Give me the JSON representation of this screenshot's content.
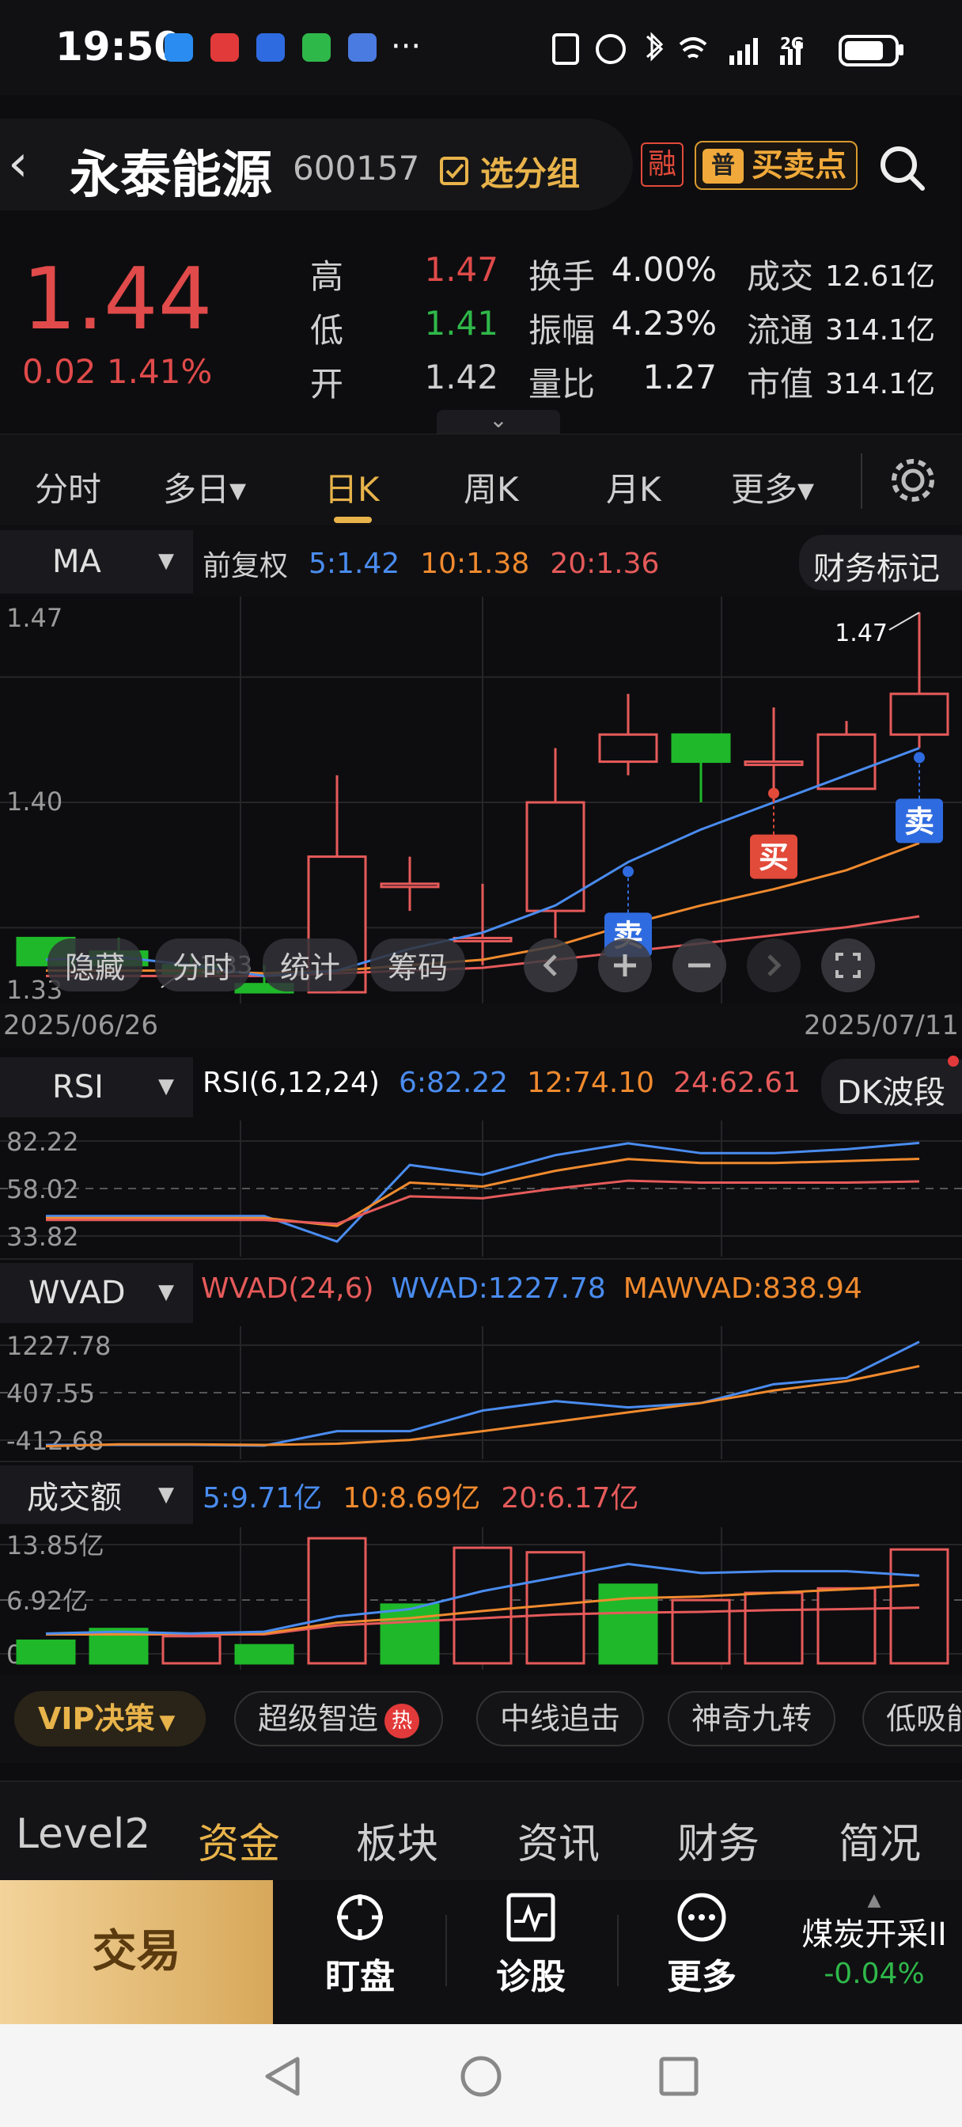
{
  "status_bar": {
    "time": "19:50",
    "more": "···",
    "network": "2G"
  },
  "header": {
    "back": "‹",
    "name": "永泰能源",
    "code": "600157",
    "group_label": "选分组",
    "rong": "融",
    "buy_sell_label": "买卖点",
    "pu": "普"
  },
  "quote": {
    "price": "1.44",
    "change": "0.02",
    "change_pct": "1.41%",
    "rows": [
      [
        {
          "k": "高",
          "v": "1.47",
          "c": "#e04a4a"
        },
        {
          "k": "换手",
          "v": "4.00%"
        },
        {
          "k": "成交",
          "v": "12.61亿"
        }
      ],
      [
        {
          "k": "低",
          "v": "1.41",
          "c": "#2fb84a"
        },
        {
          "k": "振幅",
          "v": "4.23%"
        },
        {
          "k": "流通",
          "v": "314.1亿"
        }
      ],
      [
        {
          "k": "开",
          "v": "1.42",
          "c": "#cfcfcf"
        },
        {
          "k": "量比",
          "v": "1.27"
        },
        {
          "k": "市值",
          "v": "314.1亿"
        }
      ]
    ],
    "expand": "⌄"
  },
  "tabs": {
    "items": [
      "分时",
      "多日▾",
      "日K",
      "周K",
      "月K",
      "更多▾"
    ],
    "active": 2
  },
  "ma_panel": {
    "selector": "MA",
    "adjust": "前复权",
    "ma5": "5:1.42",
    "ma10": "10:1.38",
    "ma20": "20:1.36",
    "finance_btn": "财务标记",
    "y_max": "1.47",
    "y_mid": "1.40",
    "y_min": "1.33",
    "hi_label": "1.47",
    "lo_label": "1.33",
    "date_start": "2025/06/26",
    "date_end": "2025/07/11",
    "sell_label": "卖",
    "buy_label": "买",
    "toolbar": {
      "hide": "隐藏",
      "fenshi": "分时",
      "stats": "统计",
      "chips": "筹码"
    }
  },
  "rsi_panel": {
    "selector": "RSI",
    "title": "RSI(6,12,24)",
    "v6": "6:82.22",
    "v12": "12:74.10",
    "v24": "24:62.61",
    "btn": "DK波段",
    "y1": "82.22",
    "y2": "58.02",
    "y3": "33.82"
  },
  "wvad_panel": {
    "selector": "WVAD",
    "title": "WVAD(24,6)",
    "v1": "WVAD:1227.78",
    "v2": "MAWVAD:838.94",
    "y1": "1227.78",
    "y2": "407.55",
    "y3": "-412.68"
  },
  "amount_panel": {
    "selector": "成交额",
    "v5": "5:9.71亿",
    "v10": "10:8.69亿",
    "v20": "20:6.17亿",
    "y1": "13.85亿",
    "y2": "6.92亿",
    "y3": "0.00"
  },
  "vip_row": {
    "vip": "VIP决策",
    "chips": [
      "超级智造",
      "中线追击",
      "神奇九转",
      "低吸能"
    ],
    "hot": "热"
  },
  "bottom_tabs": {
    "items": [
      "Level2",
      "资金",
      "板块",
      "资讯",
      "财务",
      "简况"
    ],
    "active": 1
  },
  "bottom_bar": {
    "trade": "交易",
    "watch": "盯盘",
    "diagnose": "诊股",
    "more": "更多",
    "sector_name": "煤炭开采II",
    "sector_change": "-0.04%"
  },
  "colors": {
    "up": "#e04a4a",
    "down": "#2fb84a",
    "ma5": "#4a8cf0",
    "ma10": "#f08a2e",
    "ma20": "#e65a5a",
    "accent": "#e8b34a"
  },
  "chart_data": [
    {
      "type": "candlestick",
      "title": "",
      "x_range": [
        "2025/06/26",
        "2025/07/11"
      ],
      "ylim": [
        1.33,
        1.47
      ],
      "candles": [
        {
          "o": 1.35,
          "h": 1.35,
          "l": 1.34,
          "c": 1.34
        },
        {
          "o": 1.345,
          "h": 1.35,
          "l": 1.34,
          "c": 1.34
        },
        {
          "o": 1.34,
          "h": 1.344,
          "l": 1.339,
          "c": 1.336
        },
        {
          "o": 1.333,
          "h": 1.34,
          "l": 1.33,
          "c": 1.33
        },
        {
          "o": 1.33,
          "h": 1.41,
          "l": 1.33,
          "c": 1.38
        },
        {
          "o": 1.37,
          "h": 1.38,
          "l": 1.36,
          "c": 1.37
        },
        {
          "o": 1.35,
          "h": 1.37,
          "l": 1.34,
          "c": 1.35
        },
        {
          "o": 1.36,
          "h": 1.42,
          "l": 1.35,
          "c": 1.4
        },
        {
          "o": 1.415,
          "h": 1.44,
          "l": 1.41,
          "c": 1.425
        },
        {
          "o": 1.425,
          "h": 1.425,
          "l": 1.4,
          "c": 1.415
        },
        {
          "o": 1.415,
          "h": 1.435,
          "l": 1.4,
          "c": 1.415
        },
        {
          "o": 1.405,
          "h": 1.43,
          "l": 1.405,
          "c": 1.425
        },
        {
          "o": 1.425,
          "h": 1.47,
          "l": 1.42,
          "c": 1.44
        }
      ],
      "ma5": [
        1.342,
        1.343,
        1.34,
        1.336,
        1.338,
        1.346,
        1.352,
        1.362,
        1.378,
        1.39,
        1.4,
        1.41,
        1.42
      ],
      "ma10": [
        1.338,
        1.338,
        1.338,
        1.337,
        1.338,
        1.34,
        1.342,
        1.347,
        1.355,
        1.362,
        1.368,
        1.375,
        1.385
      ],
      "ma20": [
        1.336,
        1.336,
        1.336,
        1.336,
        1.337,
        1.338,
        1.339,
        1.342,
        1.345,
        1.348,
        1.351,
        1.354,
        1.358
      ],
      "signals": [
        {
          "index": 8,
          "type": "卖"
        },
        {
          "index": 10,
          "type": "买"
        },
        {
          "index": 12,
          "type": "卖"
        }
      ]
    },
    {
      "type": "line",
      "title": "RSI(6,12,24)",
      "ylim": [
        30,
        88
      ],
      "series": [
        {
          "name": "6",
          "values": [
            45,
            45,
            45,
            45,
            32,
            71,
            66,
            76,
            82,
            77,
            77,
            79,
            82.22
          ]
        },
        {
          "name": "12",
          "values": [
            44,
            44,
            44,
            44,
            40,
            62,
            60,
            68,
            74,
            72,
            72,
            73,
            74.1
          ]
        },
        {
          "name": "24",
          "values": [
            43,
            43,
            43,
            43,
            41,
            55,
            54,
            59,
            63,
            62,
            62,
            62,
            62.61
          ]
        }
      ]
    },
    {
      "type": "line",
      "title": "WVAD(24,6)",
      "ylim": [
        -470,
        1300
      ],
      "series": [
        {
          "name": "WVAD",
          "values": [
            -420,
            -420,
            -420,
            -430,
            -200,
            -200,
            130,
            280,
            180,
            250,
            550,
            650,
            1227.78
          ]
        },
        {
          "name": "MAWVAD",
          "values": [
            -440,
            -410,
            -410,
            -420,
            -400,
            -340,
            -200,
            -50,
            100,
            250,
            450,
            600,
            838.94
          ]
        }
      ]
    },
    {
      "type": "bar",
      "title": "成交额",
      "ylim": [
        0,
        13.85
      ],
      "values": [
        2.5,
        3.8,
        3.0,
        2.0,
        13.85,
        6.5,
        12.8,
        12.3,
        8.7,
        7.0,
        7.8,
        8.3,
        12.61
      ],
      "up": [
        false,
        false,
        true,
        false,
        true,
        false,
        true,
        true,
        false,
        true,
        true,
        true,
        true
      ],
      "ma5": [
        3.3,
        3.5,
        3.3,
        3.5,
        5.2,
        6.0,
        8.0,
        9.5,
        11.0,
        10.0,
        10.2,
        10.2,
        9.71
      ],
      "ma10": [
        3.2,
        3.2,
        3.3,
        3.3,
        4.5,
        5.0,
        5.8,
        6.5,
        7.2,
        7.4,
        7.8,
        8.2,
        8.69
      ],
      "ma20": [
        3.2,
        3.2,
        3.2,
        3.2,
        4.2,
        4.6,
        5.0,
        5.4,
        5.6,
        5.7,
        5.9,
        6.0,
        6.17
      ]
    }
  ]
}
